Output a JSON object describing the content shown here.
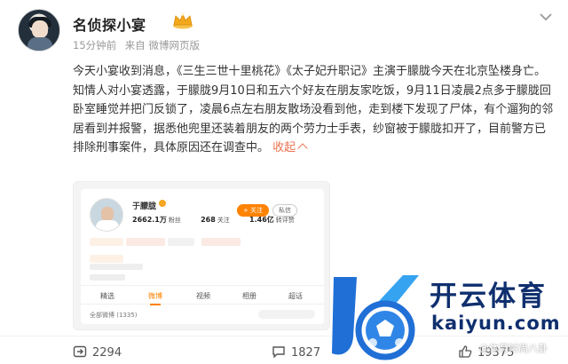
{
  "post": {
    "author": {
      "name": "名侦探小宴",
      "verified_badge": "crown-icon"
    },
    "meta": {
      "time": "15分钟前",
      "source": "来自 微博网页版"
    },
    "text_main": "今天小宴收到消息，《三生三世十里桃花》《太子妃升职记》主演于朦胧今天在北京坠楼身亡。知情人对小宴透露，于朦胧9月10日和五六个好友在朋友家吃饭，9月11日凌晨2点多于朦胧回卧室睡觉并把门反锁了，凌晨6点左右朋友散场没看到他，走到楼下发现了尸体，有个遛狗的邻居看到并报警，据悉他兜里还装着朋友的两个劳力士手表，纱窗被于朦胧扣开了，目前警方已排除刑事案件，具体原因还在调查中。",
    "fold_label": "收起"
  },
  "embed": {
    "name": "于朦胧",
    "stats": [
      {
        "value": "2662.1万",
        "label": "粉丝"
      },
      {
        "value": "268",
        "label": "关注"
      },
      {
        "value": "1.46亿",
        "label": "转评赞"
      }
    ],
    "follow_label": "+ 关注",
    "message_label": "私信",
    "tabs": [
      "精选",
      "微博",
      "视频",
      "相册",
      "超话"
    ],
    "all_label": "全部微博 (1335)"
  },
  "actions": {
    "reposts": "2294",
    "comments": "1827",
    "likes": "19375"
  },
  "watermark": {
    "brand": "开云体育",
    "domain": "kaiyun.com",
    "source": "@体育时尚八卦"
  },
  "colors": {
    "accent": "#eb7350",
    "brand_orange": "#ff8200",
    "watermark_blue": "#0f2f6e"
  }
}
